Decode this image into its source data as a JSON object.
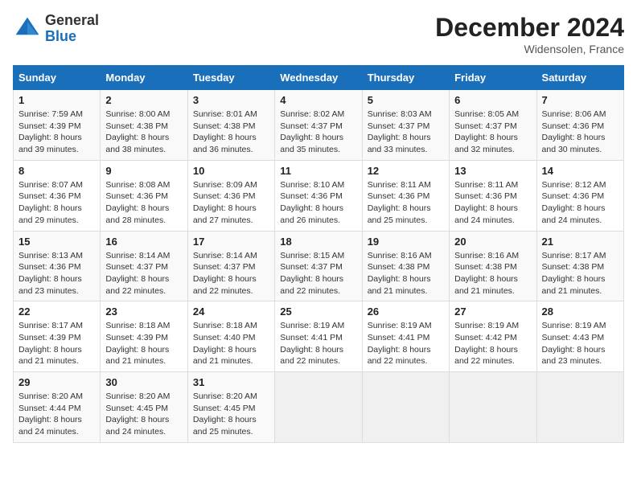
{
  "header": {
    "logo_general": "General",
    "logo_blue": "Blue",
    "month_year": "December 2024",
    "location": "Widensolen, France"
  },
  "weekdays": [
    "Sunday",
    "Monday",
    "Tuesday",
    "Wednesday",
    "Thursday",
    "Friday",
    "Saturday"
  ],
  "weeks": [
    [
      {
        "day": "1",
        "sunrise": "7:59 AM",
        "sunset": "4:39 PM",
        "daylight": "8 hours and 39 minutes."
      },
      {
        "day": "2",
        "sunrise": "8:00 AM",
        "sunset": "4:38 PM",
        "daylight": "8 hours and 38 minutes."
      },
      {
        "day": "3",
        "sunrise": "8:01 AM",
        "sunset": "4:38 PM",
        "daylight": "8 hours and 36 minutes."
      },
      {
        "day": "4",
        "sunrise": "8:02 AM",
        "sunset": "4:37 PM",
        "daylight": "8 hours and 35 minutes."
      },
      {
        "day": "5",
        "sunrise": "8:03 AM",
        "sunset": "4:37 PM",
        "daylight": "8 hours and 33 minutes."
      },
      {
        "day": "6",
        "sunrise": "8:05 AM",
        "sunset": "4:37 PM",
        "daylight": "8 hours and 32 minutes."
      },
      {
        "day": "7",
        "sunrise": "8:06 AM",
        "sunset": "4:36 PM",
        "daylight": "8 hours and 30 minutes."
      }
    ],
    [
      {
        "day": "8",
        "sunrise": "8:07 AM",
        "sunset": "4:36 PM",
        "daylight": "8 hours and 29 minutes."
      },
      {
        "day": "9",
        "sunrise": "8:08 AM",
        "sunset": "4:36 PM",
        "daylight": "8 hours and 28 minutes."
      },
      {
        "day": "10",
        "sunrise": "8:09 AM",
        "sunset": "4:36 PM",
        "daylight": "8 hours and 27 minutes."
      },
      {
        "day": "11",
        "sunrise": "8:10 AM",
        "sunset": "4:36 PM",
        "daylight": "8 hours and 26 minutes."
      },
      {
        "day": "12",
        "sunrise": "8:11 AM",
        "sunset": "4:36 PM",
        "daylight": "8 hours and 25 minutes."
      },
      {
        "day": "13",
        "sunrise": "8:11 AM",
        "sunset": "4:36 PM",
        "daylight": "8 hours and 24 minutes."
      },
      {
        "day": "14",
        "sunrise": "8:12 AM",
        "sunset": "4:36 PM",
        "daylight": "8 hours and 24 minutes."
      }
    ],
    [
      {
        "day": "15",
        "sunrise": "8:13 AM",
        "sunset": "4:36 PM",
        "daylight": "8 hours and 23 minutes."
      },
      {
        "day": "16",
        "sunrise": "8:14 AM",
        "sunset": "4:37 PM",
        "daylight": "8 hours and 22 minutes."
      },
      {
        "day": "17",
        "sunrise": "8:14 AM",
        "sunset": "4:37 PM",
        "daylight": "8 hours and 22 minutes."
      },
      {
        "day": "18",
        "sunrise": "8:15 AM",
        "sunset": "4:37 PM",
        "daylight": "8 hours and 22 minutes."
      },
      {
        "day": "19",
        "sunrise": "8:16 AM",
        "sunset": "4:38 PM",
        "daylight": "8 hours and 21 minutes."
      },
      {
        "day": "20",
        "sunrise": "8:16 AM",
        "sunset": "4:38 PM",
        "daylight": "8 hours and 21 minutes."
      },
      {
        "day": "21",
        "sunrise": "8:17 AM",
        "sunset": "4:38 PM",
        "daylight": "8 hours and 21 minutes."
      }
    ],
    [
      {
        "day": "22",
        "sunrise": "8:17 AM",
        "sunset": "4:39 PM",
        "daylight": "8 hours and 21 minutes."
      },
      {
        "day": "23",
        "sunrise": "8:18 AM",
        "sunset": "4:39 PM",
        "daylight": "8 hours and 21 minutes."
      },
      {
        "day": "24",
        "sunrise": "8:18 AM",
        "sunset": "4:40 PM",
        "daylight": "8 hours and 21 minutes."
      },
      {
        "day": "25",
        "sunrise": "8:19 AM",
        "sunset": "4:41 PM",
        "daylight": "8 hours and 22 minutes."
      },
      {
        "day": "26",
        "sunrise": "8:19 AM",
        "sunset": "4:41 PM",
        "daylight": "8 hours and 22 minutes."
      },
      {
        "day": "27",
        "sunrise": "8:19 AM",
        "sunset": "4:42 PM",
        "daylight": "8 hours and 22 minutes."
      },
      {
        "day": "28",
        "sunrise": "8:19 AM",
        "sunset": "4:43 PM",
        "daylight": "8 hours and 23 minutes."
      }
    ],
    [
      {
        "day": "29",
        "sunrise": "8:20 AM",
        "sunset": "4:44 PM",
        "daylight": "8 hours and 24 minutes."
      },
      {
        "day": "30",
        "sunrise": "8:20 AM",
        "sunset": "4:45 PM",
        "daylight": "8 hours and 24 minutes."
      },
      {
        "day": "31",
        "sunrise": "8:20 AM",
        "sunset": "4:45 PM",
        "daylight": "8 hours and 25 minutes."
      },
      null,
      null,
      null,
      null
    ]
  ],
  "labels": {
    "sunrise": "Sunrise:",
    "sunset": "Sunset:",
    "daylight": "Daylight:"
  }
}
